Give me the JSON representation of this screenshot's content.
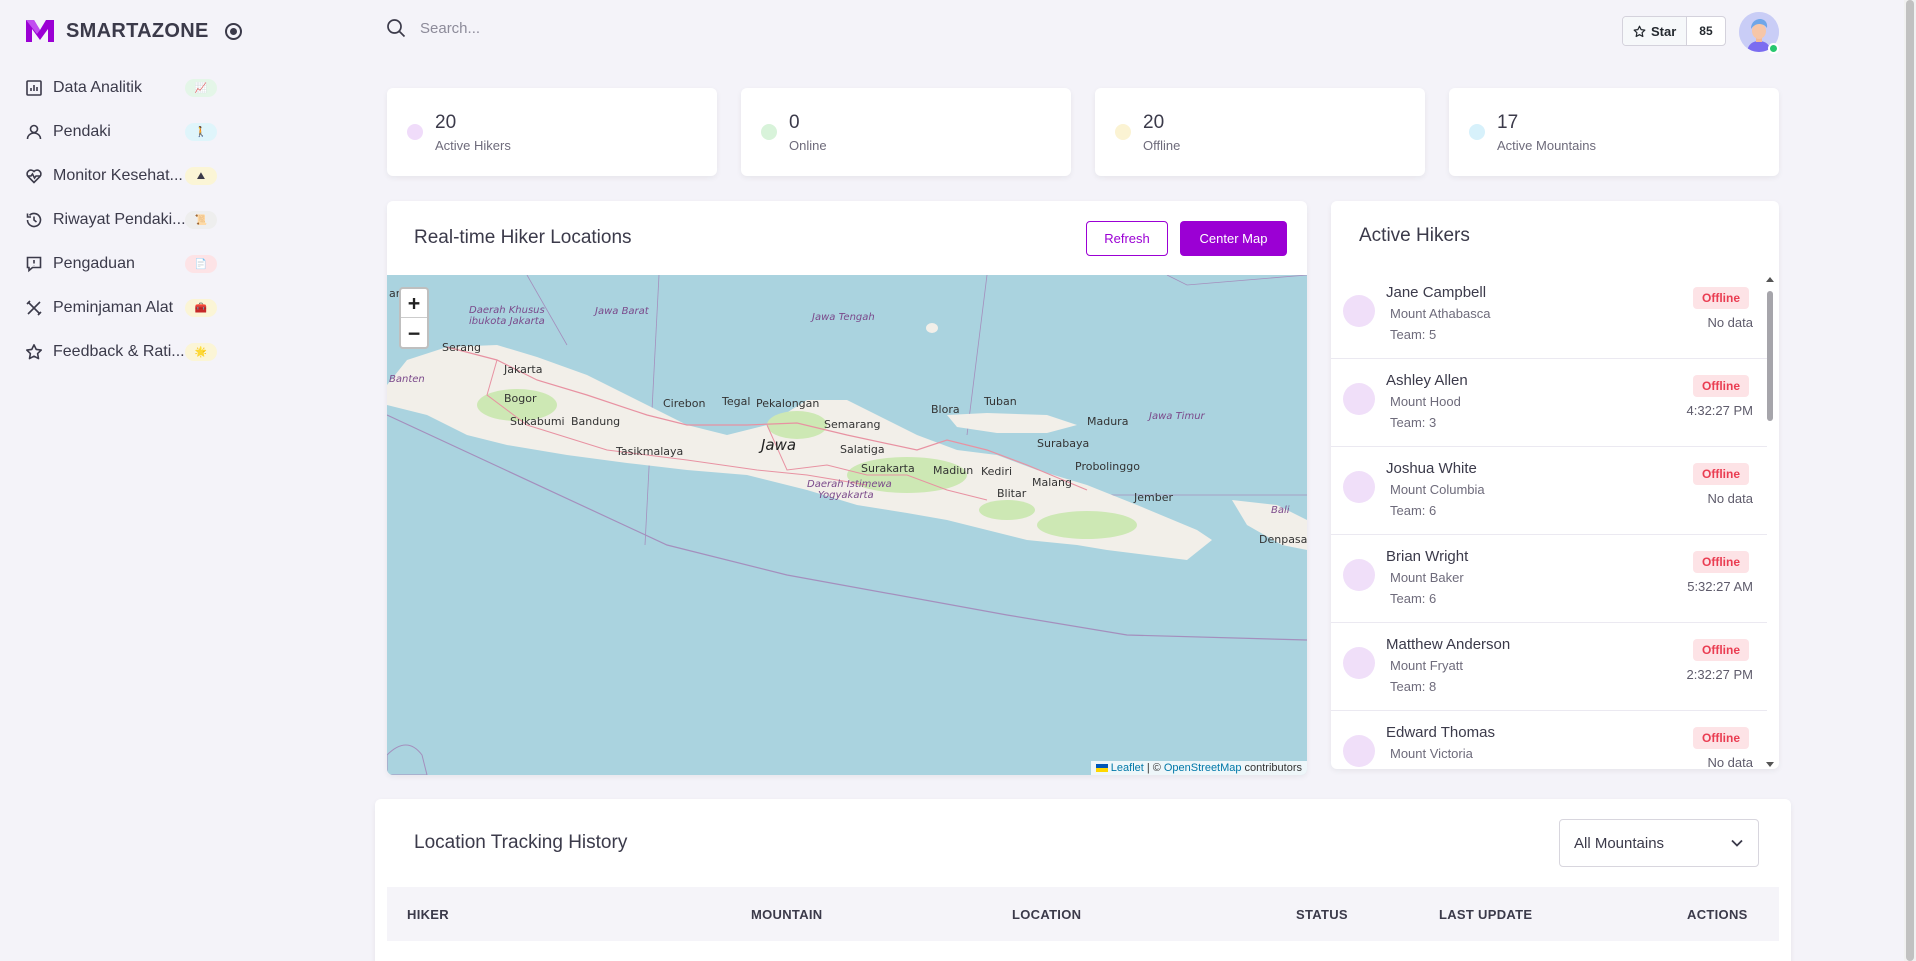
{
  "brand": {
    "name": "SMARTAZONE",
    "color": "#9b00d4"
  },
  "sidebar": {
    "items": [
      {
        "label": "Data Analitik",
        "icon": "bar-chart-icon",
        "badge": "📈",
        "badge_color": "#e4f6e8"
      },
      {
        "label": "Pendaki",
        "icon": "user-icon",
        "badge": "🚶",
        "badge_color": "#dff5fb"
      },
      {
        "label": "Monitor Kesehat...",
        "icon": "heart-pulse-icon",
        "badge": "⛰",
        "badge_color": "#fbf5d6"
      },
      {
        "label": "Riwayat Pendaki...",
        "icon": "history-icon",
        "badge": "📜",
        "badge_color": "#eeeeee"
      },
      {
        "label": "Pengaduan",
        "icon": "report-icon",
        "badge": "📄",
        "badge_color": "#fde3e6"
      },
      {
        "label": "Peminjaman Alat",
        "icon": "tools-icon",
        "badge": "🧰",
        "badge_color": "#fbf5d6"
      },
      {
        "label": "Feedback & Rati...",
        "icon": "star-icon",
        "badge": "🌟",
        "badge_color": "#fbf5d6"
      }
    ]
  },
  "topbar": {
    "search_placeholder": "Search...",
    "star_label": "Star",
    "star_count": "85"
  },
  "stats": [
    {
      "value": "20",
      "label": "Active Hikers",
      "color": "#f0dcfa"
    },
    {
      "value": "0",
      "label": "Online",
      "color": "#d8f3da"
    },
    {
      "value": "20",
      "label": "Offline",
      "color": "#fbf3d3"
    },
    {
      "value": "17",
      "label": "Active Mountains",
      "color": "#d7f1fb"
    }
  ],
  "map": {
    "title": "Real-time Hiker Locations",
    "refresh_label": "Refresh",
    "center_label": "Center Map",
    "zoom_in": "+",
    "zoom_out": "−",
    "attribution": {
      "leaflet": "Leaflet",
      "separator": "| ©",
      "osm": "OpenStreetMap",
      "suffix": "contributors"
    },
    "labels": {
      "jawa": "Jawa",
      "serang": "Serang",
      "jakarta": "Jakarta",
      "bogor": "Bogor",
      "sukabumi": "Sukabumi",
      "bandung": "Bandung",
      "tasikmalaya": "Tasikmalaya",
      "cirebon": "Cirebon",
      "tegal": "Tegal",
      "pekalongan": "Pekalongan",
      "semarang": "Semarang",
      "salatiga": "Salatiga",
      "surakarta": "Surakarta",
      "madiun": "Madiun",
      "kediri": "Kediri",
      "blitar": "Blitar",
      "malang": "Malang",
      "blora": "Blora",
      "tuban": "Tuban",
      "surabaya": "Surabaya",
      "probolinggo": "Probolinggo",
      "jember": "Jember",
      "madura": "Madura",
      "denpasar": "Denpasar",
      "bali": "Bali",
      "banten": "Banten",
      "jawa_barat": "Jawa Barat",
      "jawa_tengah": "Jawa Tengah",
      "jawa_timur": "Jawa Timur",
      "dki_1": "Daerah Khusus",
      "dki_2": "ibukota Jakarta",
      "diy_1": "Daerah Istimewa",
      "diy_2": "Yogyakarta",
      "edge": "am"
    }
  },
  "hikers": {
    "title": "Active Hikers",
    "items": [
      {
        "name": "Jane Campbell",
        "mountain": "Mount Athabasca",
        "team": "Team: 5",
        "status": "Offline",
        "time": "No data"
      },
      {
        "name": "Ashley Allen",
        "mountain": "Mount Hood",
        "team": "Team: 3",
        "status": "Offline",
        "time": "4:32:27 PM"
      },
      {
        "name": "Joshua White",
        "mountain": "Mount Columbia",
        "team": "Team: 6",
        "status": "Offline",
        "time": "No data"
      },
      {
        "name": "Brian Wright",
        "mountain": "Mount Baker",
        "team": "Team: 6",
        "status": "Offline",
        "time": "5:32:27 AM"
      },
      {
        "name": "Matthew Anderson",
        "mountain": "Mount Fryatt",
        "team": "Team: 8",
        "status": "Offline",
        "time": "2:32:27 PM"
      },
      {
        "name": "Edward Thomas",
        "mountain": "Mount Victoria",
        "team": "",
        "status": "Offline",
        "time": "No data"
      }
    ]
  },
  "history": {
    "title": "Location Tracking History",
    "filter_value": "All Mountains",
    "columns": [
      "HIKER",
      "MOUNTAIN",
      "LOCATION",
      "STATUS",
      "LAST UPDATE",
      "ACTIONS"
    ]
  }
}
